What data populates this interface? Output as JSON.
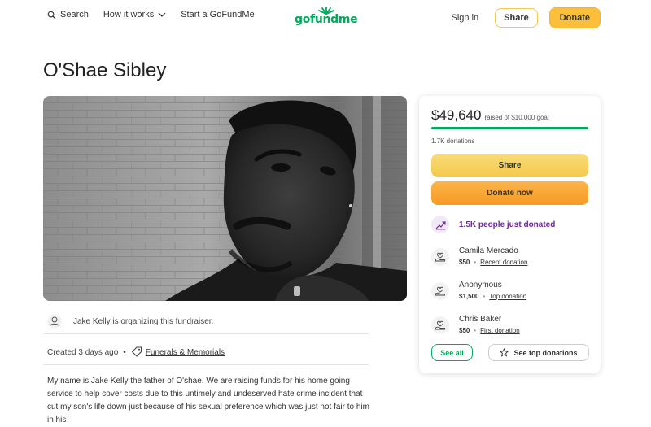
{
  "header": {
    "search_label": "Search",
    "how_it_works_label": "How it works",
    "start_label": "Start a GoFundMe",
    "logo_text": "gofundme",
    "signin_label": "Sign in",
    "share_label": "Share",
    "donate_label": "Donate"
  },
  "page": {
    "title": "O'Shae Sibley"
  },
  "organizer": {
    "text": "Jake Kelly is organizing this fundraiser."
  },
  "meta": {
    "created": "Created 3 days ago",
    "separator": "•",
    "category": "Funerals & Memorials"
  },
  "story": {
    "text": "My name is Jake Kelly the father of O'shae. We are raising funds for his home going service to help cover costs due to this untimely and undeserved hate crime incident that cut my son's life down just because of his sexual preference which was just not fair to him in his"
  },
  "donation_card": {
    "amount": "$49,640",
    "goal_text": "raised of $10,000 goal",
    "progress_fraction": 1.0,
    "donations_count": "1.7K donations",
    "share_label": "Share",
    "donate_label": "Donate now",
    "recent_text": "1.5K people just donated",
    "donors": [
      {
        "name": "Camila Mercado",
        "amount": "$50",
        "separator": "•",
        "kind": "Recent donation"
      },
      {
        "name": "Anonymous",
        "amount": "$1,500",
        "separator": "•",
        "kind": "Top donation"
      },
      {
        "name": "Chris Baker",
        "amount": "$50",
        "separator": "•",
        "kind": "First donation"
      }
    ],
    "see_all_label": "See all",
    "see_top_label": "See top donations"
  },
  "colors": {
    "brand_green": "#02a95c",
    "donate_orange": "#f79a24",
    "share_yellow": "#f3c94a",
    "recent_purple": "#6a2c91"
  }
}
